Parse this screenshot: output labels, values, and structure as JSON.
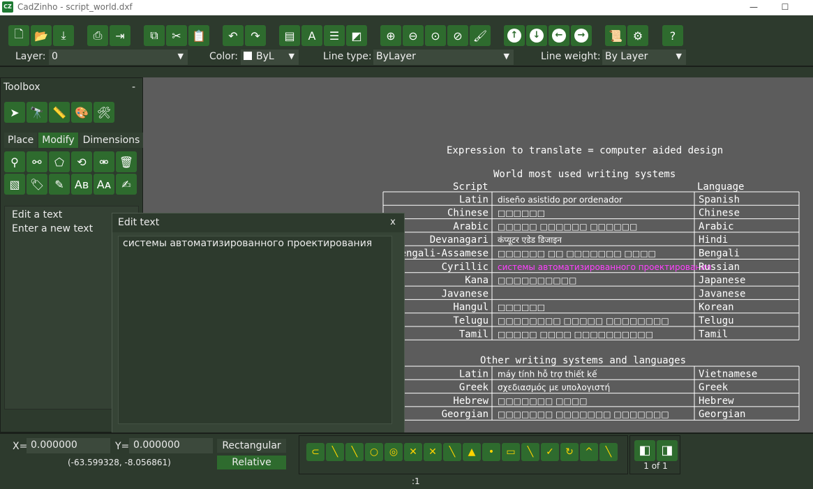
{
  "window": {
    "title": "CadZinho - script_world.dxf",
    "app_icon": "CZ",
    "minimize": "—",
    "maximize": "☐"
  },
  "toolbar": {
    "icons": [
      "new-file-icon",
      "open-icon",
      "save-icon",
      "print-icon",
      "export-icon",
      "copy-icon",
      "cut-icon",
      "paste-icon",
      "undo-icon",
      "redo-icon",
      "layers-icon",
      "text-style-icon",
      "line-type-icon",
      "dimension-style-icon",
      "zoom-in-icon",
      "zoom-out-icon",
      "zoom-window-icon",
      "zoom-all-icon",
      "brush-icon",
      "arrow-up-icon",
      "arrow-down-icon",
      "arrow-left-icon",
      "arrow-right-icon",
      "script-icon",
      "gear-icon",
      "help-icon"
    ],
    "layer_label": "Layer:",
    "layer_value": "0",
    "color_label": "Color:",
    "color_value": "ByL",
    "linetype_label": "Line type:",
    "linetype_value": "ByLayer",
    "lineweight_label": "Line weight:",
    "lineweight_value": "By Layer"
  },
  "toolbox": {
    "title": "Toolbox",
    "minimize": "-",
    "top_icons": [
      "select-icon",
      "find-icon",
      "measure-icon",
      "paint-icon",
      "tools-icon"
    ],
    "tabs": [
      "Place",
      "Modify",
      "Dimensions"
    ],
    "active_tab": "Modify",
    "modify_icons": [
      "move-icon",
      "duplicate-icon",
      "scale-icon",
      "rotate-icon",
      "mirror-icon",
      "delete-icon",
      "explode-icon",
      "tag-icon",
      "edit-icon",
      "text-edit-icon",
      "text-replace-icon",
      "properties-icon"
    ],
    "list": [
      "Edit a text",
      "Enter a new text"
    ]
  },
  "dialog": {
    "title": "Edit text",
    "close": "x",
    "text": "системы автоматизированного проектирования"
  },
  "drawing": {
    "expression": "Expression to translate = computer aided design",
    "section1_title": "World most used writing systems",
    "col_script": "Script",
    "col_language": "Language",
    "rows": [
      {
        "script": "Latin",
        "text": "diseño asistido por ordenador",
        "language": "Spanish"
      },
      {
        "script": "Chinese",
        "text": "□□□□□□",
        "language": "Chinese"
      },
      {
        "script": "Arabic",
        "text": "□□□□□ □□□□□□ □□□□□□",
        "language": "Arabic"
      },
      {
        "script": "Devanagari",
        "text": "कंप्यूटर एडेड डिजाइन",
        "language": "Hindi"
      },
      {
        "script": "Bengali-Assamese",
        "text": "□□□□□□ □□ □□□□□□□ □□□□",
        "language": "Bengali"
      },
      {
        "script": "Cyrillic",
        "text": "системы автоматизированного проектирования",
        "language": "Russian"
      },
      {
        "script": "Kana",
        "text": "□□□□□□□□□□",
        "language": "Japanese"
      },
      {
        "script": "Javanese",
        "text": "",
        "language": "Javanese"
      },
      {
        "script": "Hangul",
        "text": "□□□□□□",
        "language": "Korean"
      },
      {
        "script": "Telugu",
        "text": "□□□□□□□□ □□□□□ □□□□□□□□",
        "language": "Telugu"
      },
      {
        "script": "Tamil",
        "text": "□□□□□ □□□□ □□□□□□□□□□",
        "language": "Tamil"
      }
    ],
    "section2_title": "Other writing systems and languages",
    "rows2": [
      {
        "script": "Latin",
        "text": "máy tính hỗ trợ thiết kế",
        "language": "Vietnamese"
      },
      {
        "script": "Greek",
        "text": "σχεδιασμός με υπολογιστή",
        "language": "Greek"
      },
      {
        "script": "Hebrew",
        "text": "□□□□□□□ □□□□",
        "language": "Hebrew"
      },
      {
        "script": "Georgian",
        "text": "□□□□□□□ □□□□□□□ □□□□□□□",
        "language": "Georgian"
      }
    ],
    "highlight_color": "#ff40ff",
    "line_color": "#ffffff"
  },
  "status": {
    "x_label": "X=",
    "x_value": "0.000000",
    "y_label": "Y=",
    "y_value": "0.000000",
    "mouse_coords": "(-63.599328,  -8.056861)",
    "mode1": "Rectangular",
    "mode2": "Relative",
    "snap_icons": [
      "magnet-icon",
      "snap-endpoint-icon",
      "snap-midpoint-icon",
      "snap-center-icon",
      "snap-quadrant-icon",
      "snap-intersection-icon",
      "snap-extension-icon",
      "snap-parallel-icon",
      "snap-insert-icon",
      "snap-node-icon",
      "snap-rectangle-icon",
      "snap-perpendicular-icon",
      "snap-tangent-icon",
      "snap-rotate-icon",
      "snap-nearest-icon",
      "snap-ortho-icon"
    ],
    "page_prev": "prev-page-icon",
    "page_next": "next-page-icon",
    "page_info": "1 of 1",
    "zoom": ":1"
  }
}
